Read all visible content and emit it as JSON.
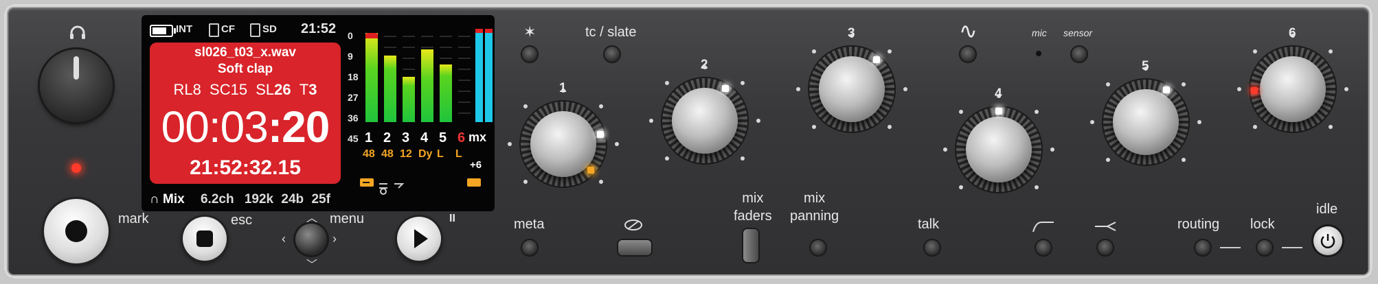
{
  "status": {
    "battery": "INT",
    "cf": "CF",
    "sd": "SD",
    "clock": "21:52"
  },
  "file": {
    "name": "sl026_t03_x.wav",
    "note": "Soft clap"
  },
  "reel": {
    "rl_label": "RL",
    "rl": "8",
    "sc_label": "SC",
    "sc": "15",
    "sl_label": "SL",
    "sl": "26",
    "t_label": "T",
    "t": "3"
  },
  "timecode": {
    "a": "00:03",
    "b": ":20"
  },
  "clock_tc": "21:52:32.15",
  "meter_scale": [
    "0",
    "9",
    "18",
    "27",
    "36",
    "45"
  ],
  "channels": [
    {
      "label": "1",
      "level": 0.93,
      "rate": "48"
    },
    {
      "label": "2",
      "level": 0.69,
      "rate": "48"
    },
    {
      "label": "3",
      "level": 0.47,
      "rate": "12"
    },
    {
      "label": "4",
      "level": 0.76,
      "rate": "Dy"
    },
    {
      "label": "5",
      "level": 0.6,
      "rate": "L"
    },
    {
      "label": "6",
      "level": 0.0,
      "rate": "L"
    }
  ],
  "mx": {
    "label": "mx",
    "gain": "+6",
    "level": 0.97
  },
  "bottom_status": {
    "mode": "Mix",
    "ch": "6.2ch",
    "rate": "192k",
    "bits": "24b",
    "fps": "25f"
  },
  "labels": {
    "mark": "mark",
    "esc": "esc",
    "menu": "menu",
    "pause": "II",
    "tc_slate": "tc / slate",
    "meta": "meta",
    "mix_faders": "mix\nfaders",
    "mix_panning": "mix\npanning",
    "talk": "talk",
    "mic": "mic",
    "sensor": "sensor",
    "routing": "routing",
    "lock": "lock",
    "idle": "idle",
    "star": "✶",
    "wave": "∿"
  },
  "knobs": [
    {
      "label": "1",
      "level": 0.78
    },
    {
      "label": "2",
      "level": 0.62
    },
    {
      "label": "3",
      "level": 0.65
    },
    {
      "label": "4",
      "level": 0.5
    },
    {
      "label": "5",
      "level": 0.62
    },
    {
      "label": "6",
      "level": 0.16
    }
  ],
  "colors": {
    "screen_red": "#d8242a",
    "meter_cyan": "#1ec8e8",
    "accent_orange": "#f5a623",
    "led_red": "#ff3a2a"
  }
}
